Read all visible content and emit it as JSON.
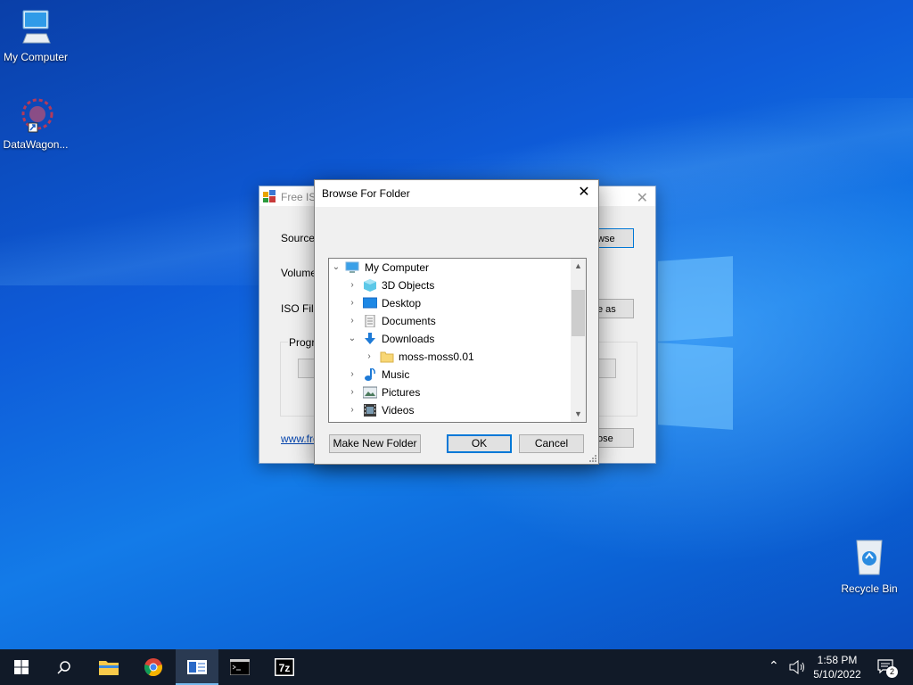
{
  "desktop": {
    "icons": [
      {
        "label": "My Computer"
      },
      {
        "label": "DataWagon..."
      },
      {
        "label": "Recycle Bin"
      }
    ]
  },
  "iso_window": {
    "title": "Free ISO",
    "source_label": "Source",
    "volume_label": "Volume",
    "iso_file_label": "ISO File",
    "progress_label": "Progre",
    "browse_button": "wse",
    "save_as_button": "e as",
    "close_button": "ose",
    "link_text": "www.fre"
  },
  "dialog": {
    "title": "Browse For Folder",
    "tree": [
      {
        "label": "My Computer",
        "icon": "computer-icon",
        "expanded": true
      },
      {
        "label": "3D Objects",
        "icon": "3d-objects-icon"
      },
      {
        "label": "Desktop",
        "icon": "desktop-icon"
      },
      {
        "label": "Documents",
        "icon": "documents-icon"
      },
      {
        "label": "Downloads",
        "icon": "downloads-icon",
        "expanded": true
      },
      {
        "label": "moss-moss0.01",
        "icon": "folder-icon"
      },
      {
        "label": "Music",
        "icon": "music-icon"
      },
      {
        "label": "Pictures",
        "icon": "pictures-icon"
      },
      {
        "label": "Videos",
        "icon": "videos-icon"
      }
    ],
    "buttons": {
      "make_new_folder": "Make New Folder",
      "ok": "OK",
      "cancel": "Cancel"
    }
  },
  "taskbar": {
    "apps": [
      "start-icon",
      "search-icon",
      "file-explorer-icon",
      "chrome-icon",
      "free-iso-creator-icon",
      "terminal-icon",
      "7zip-icon"
    ],
    "time": "1:58 PM",
    "date": "5/10/2022",
    "notification_count": "2"
  }
}
